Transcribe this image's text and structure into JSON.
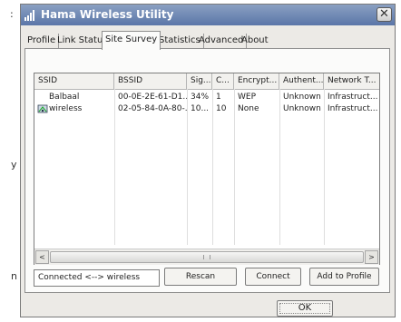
{
  "stray_text": [
    ":",
    "y",
    "n"
  ],
  "window": {
    "title": "Hama Wireless Utility",
    "close_glyph": "✕"
  },
  "tabs": [
    {
      "label": "Profile"
    },
    {
      "label": "Link Status"
    },
    {
      "label": "Site Survey",
      "active": true
    },
    {
      "label": "Statistics"
    },
    {
      "label": "Advanced"
    },
    {
      "label": "About"
    }
  ],
  "table": {
    "columns": [
      "SSID",
      "BSSID",
      "Sig...",
      "C...",
      "Encrypt...",
      "Authent...",
      "Network T..."
    ],
    "rows": [
      {
        "ssid": "Balbaal",
        "bssid": "00-0E-2E-61-D1...",
        "signal": "34%",
        "channel": "1",
        "encryption": "WEP",
        "authentication": "Unknown",
        "network_type": "Infrastruct...",
        "connected": false
      },
      {
        "ssid": "wireless",
        "bssid": "02-05-84-0A-80-...",
        "signal": "10...",
        "channel": "10",
        "encryption": "None",
        "authentication": "Unknown",
        "network_type": "Infrastruct...",
        "connected": true
      }
    ]
  },
  "scrollbar": {
    "left_arrow": "<",
    "right_arrow": ">"
  },
  "status_text": "Connected <--> wireless",
  "buttons": {
    "rescan": "Rescan",
    "connect": "Connect",
    "add_to_profile": "Add to Profile",
    "ok": "OK"
  },
  "icons": {
    "title_icon": "signal-bars-icon",
    "connected_icon": "wireless-connected-icon"
  },
  "colors": {
    "titlebar": "#6f88b6",
    "dialog": "#eceae6",
    "panel": "#fbfbfa"
  }
}
